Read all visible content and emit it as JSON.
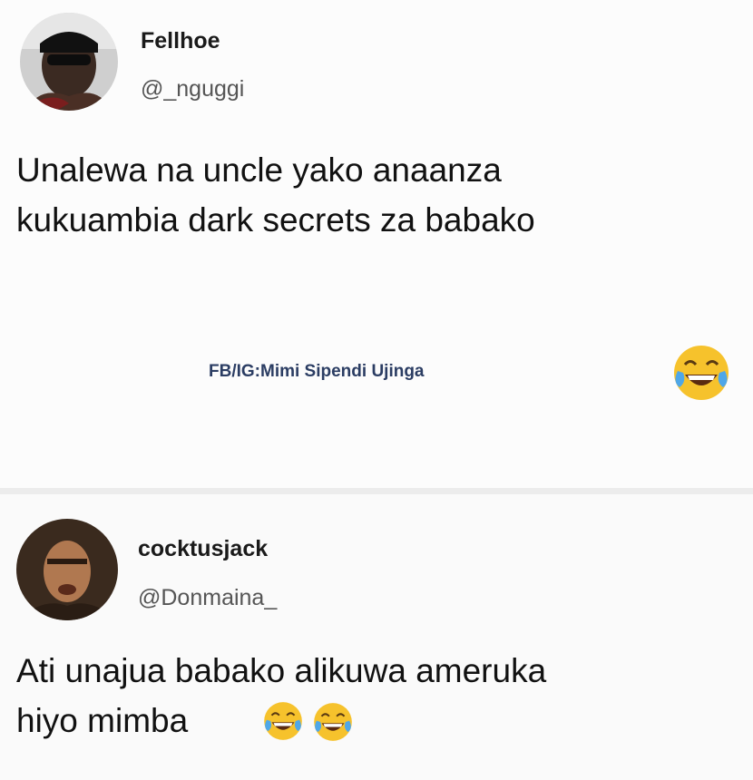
{
  "posts": [
    {
      "display_name": "Fellhoe",
      "handle": "@_nguggi",
      "text_lines": [
        "Unalewa na uncle yako anaanza",
        "kukuambia dark secrets za babako"
      ]
    },
    {
      "display_name": "cocktusjack",
      "handle": "@Donmaina_",
      "text_lines": [
        "Ati unajua babako alikuwa ameruka",
        "hiyo mimba"
      ]
    }
  ],
  "watermark": "FB/IG:Mimi Sipendi Ujinga",
  "emojis": {
    "first_post": "face-with-tears-of-joy",
    "second_post": [
      "face-with-tears-of-joy",
      "face-with-tears-of-joy"
    ]
  },
  "colors": {
    "watermark": "#2b3d63",
    "handle": "#555555",
    "emoji_face": "#f6c22c"
  }
}
